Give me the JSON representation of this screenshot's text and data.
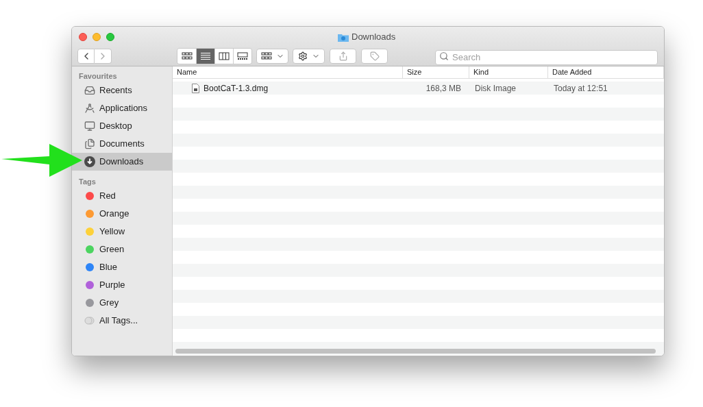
{
  "window": {
    "title": "Downloads"
  },
  "toolbar": {
    "views": [
      {
        "kind": "icons",
        "selected": false
      },
      {
        "kind": "list",
        "selected": true
      },
      {
        "kind": "columns",
        "selected": false
      },
      {
        "kind": "gallery",
        "selected": false
      }
    ],
    "search": {
      "placeholder": "Search"
    }
  },
  "sidebar": {
    "sections": [
      {
        "title": "Favourites",
        "items": [
          {
            "label": "Recents",
            "kind": "recents",
            "selected": false
          },
          {
            "label": "Applications",
            "kind": "applications",
            "selected": false
          },
          {
            "label": "Desktop",
            "kind": "desktop",
            "selected": false
          },
          {
            "label": "Documents",
            "kind": "documents",
            "selected": false
          },
          {
            "label": "Downloads",
            "kind": "downloads",
            "selected": true
          }
        ]
      },
      {
        "title": "Tags",
        "items": [
          {
            "label": "Red",
            "kind": "tag",
            "color": "#fc4a4a",
            "selected": false
          },
          {
            "label": "Orange",
            "kind": "tag",
            "color": "#fd9a33",
            "selected": false
          },
          {
            "label": "Yellow",
            "kind": "tag",
            "color": "#fdd13a",
            "selected": false
          },
          {
            "label": "Green",
            "kind": "tag",
            "color": "#4cd460",
            "selected": false
          },
          {
            "label": "Blue",
            "kind": "tag",
            "color": "#2e85f7",
            "selected": false
          },
          {
            "label": "Purple",
            "kind": "tag",
            "color": "#b061da",
            "selected": false
          },
          {
            "label": "Grey",
            "kind": "tag",
            "color": "#98989d",
            "selected": false
          },
          {
            "label": "All Tags...",
            "kind": "all-tags",
            "selected": false
          }
        ]
      }
    ]
  },
  "table": {
    "columns": [
      "Name",
      "Size",
      "Kind",
      "Date Added"
    ],
    "rows": [
      {
        "name": "BootCaT-1.3.dmg",
        "size": "168,3 MB",
        "kind": "Disk Image",
        "date_added": "Today at 12:51",
        "selected": false
      }
    ]
  }
}
